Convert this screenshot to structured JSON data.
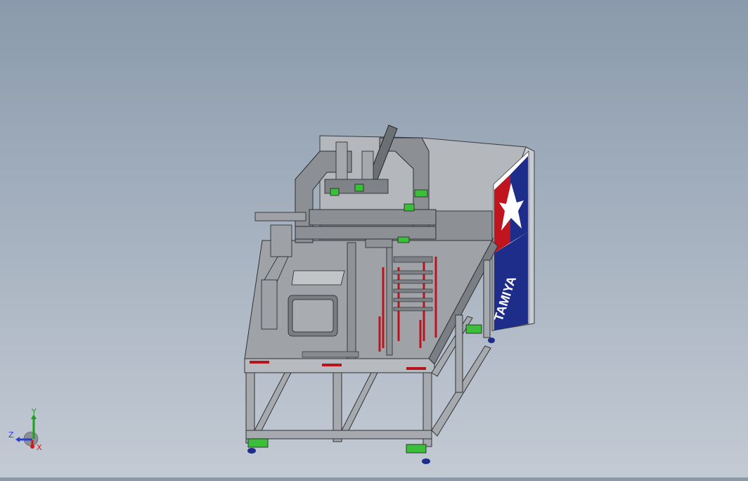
{
  "viewport": {
    "model": "machine-assembly",
    "logo_text": "TAMIYA"
  },
  "triad": {
    "axes": [
      {
        "label": "Y",
        "color": "#1aa01a"
      },
      {
        "label": "Z",
        "color": "#2a40d0"
      },
      {
        "label": "X",
        "color": "#d01a1a"
      }
    ]
  },
  "colors": {
    "background_top": "#8a9aac",
    "background_bottom": "#c3cad4",
    "metal": "#9a9ea3",
    "metal_dark": "#5e6266",
    "logo_blue": "#1e2c8a",
    "logo_red": "#c0151f",
    "rod_red": "#b8141c",
    "accent_green": "#3bbf3b"
  }
}
